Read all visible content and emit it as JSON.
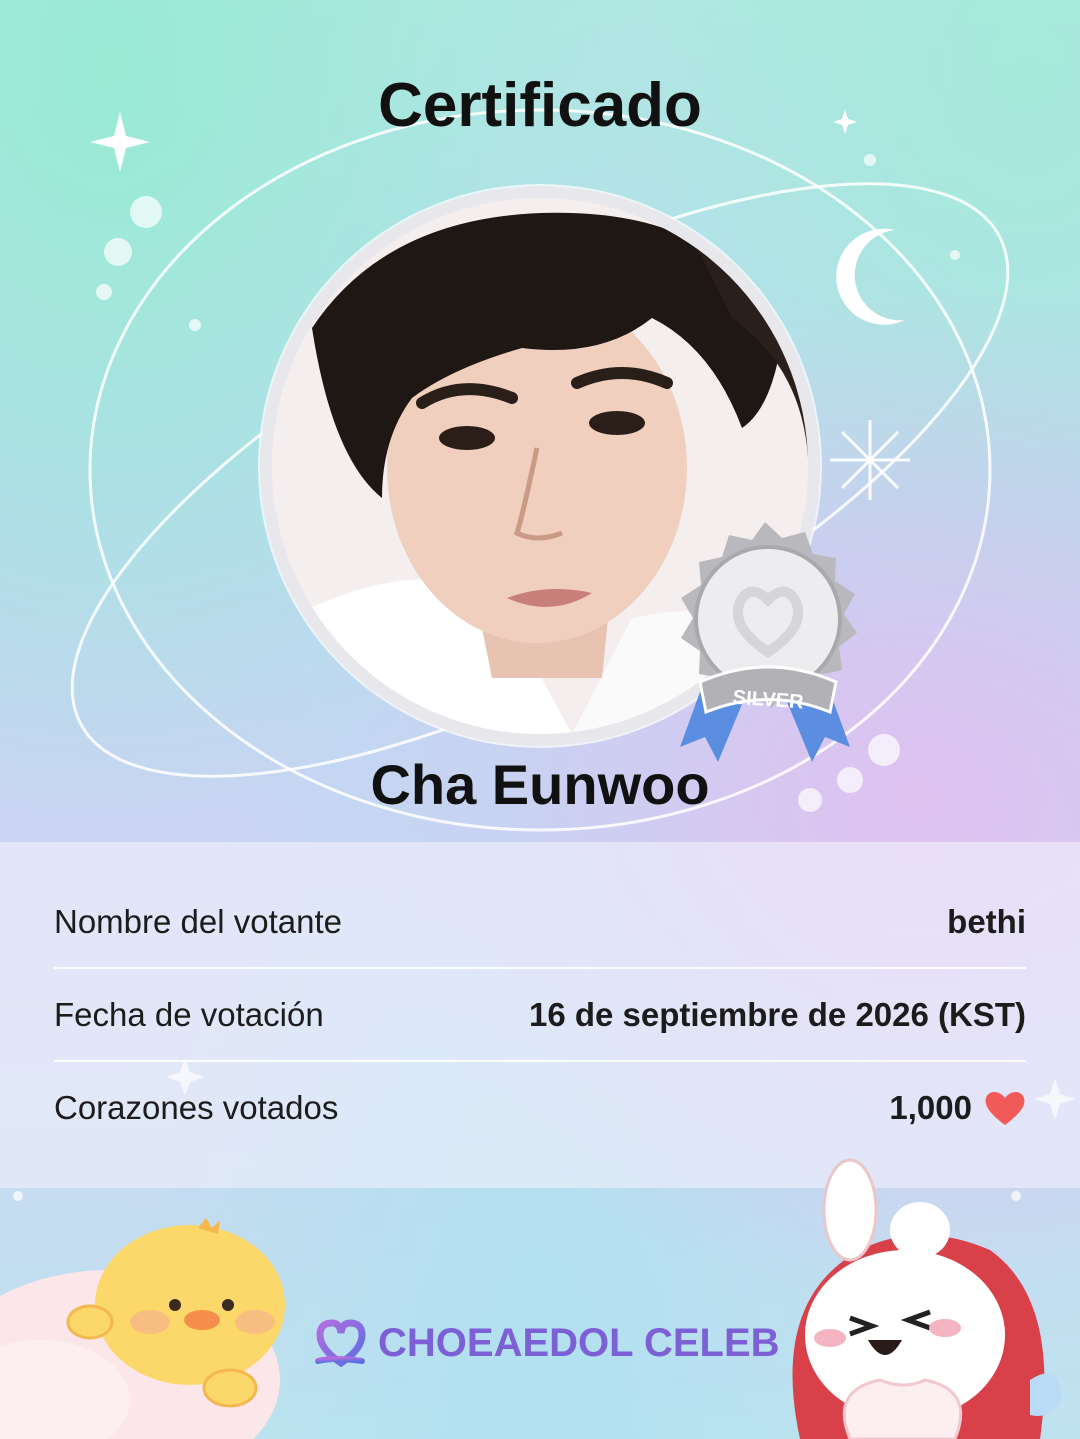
{
  "certificate": {
    "title": "Certificado",
    "celebrity_name": "Cha Eunwoo",
    "badge_label": "SILVER"
  },
  "details": [
    {
      "label": "Nombre del votante",
      "value": "bethi"
    },
    {
      "label": "Fecha de votación",
      "value": "16 de septiembre de 2026 (KST)"
    },
    {
      "label": "Corazones votados",
      "value": "1,000"
    }
  ],
  "brand": {
    "name": "CHOEAEDOL CELEB"
  },
  "colors": {
    "heart": "#f25a5a",
    "brand": "#7d5fd6",
    "badge_silver": "#c9c9cc",
    "ribbon_blue": "#5b8ee0"
  },
  "icons": [
    "sparkle-icon",
    "moon-icon",
    "silver-medal-icon",
    "heart-icon",
    "choeaedol-logo-icon",
    "chick-mascot",
    "bunny-mascot"
  ]
}
